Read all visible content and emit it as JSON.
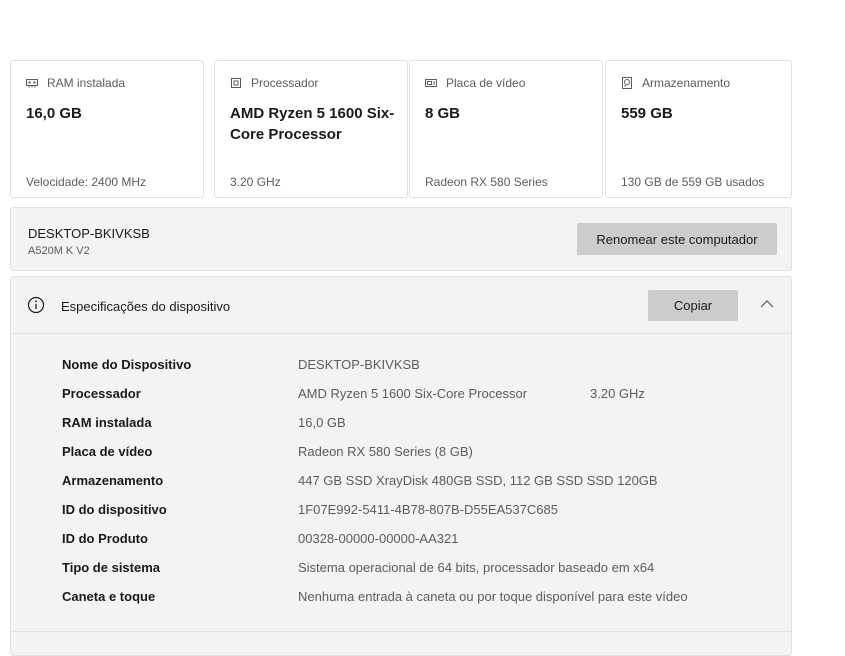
{
  "cards": [
    {
      "icon": "ram-icon",
      "title": "RAM instalada",
      "value": "16,0 GB",
      "footer": "Velocidade: 2400 MHz"
    },
    {
      "icon": "processor-icon",
      "title": "Processador",
      "value": "AMD Ryzen 5 1600 Six-Core Processor",
      "footer": "3.20 GHz"
    },
    {
      "icon": "gpu-icon",
      "title": "Placa de vídeo",
      "value": "8 GB",
      "footer": "Radeon RX 580 Series"
    },
    {
      "icon": "storage-icon",
      "title": "Armazenamento",
      "value": "559 GB",
      "footer": "130 GB de 559 GB usados"
    }
  ],
  "device": {
    "name": "DESKTOP-BKIVKSB",
    "model": "A520M K V2",
    "rename_label": "Renomear este computador"
  },
  "specs": {
    "title": "Especificações do dispositivo",
    "copy_label": "Copiar",
    "rows": [
      {
        "label": "Nome do Dispositivo",
        "value": "DESKTOP-BKIVKSB",
        "extra": ""
      },
      {
        "label": "Processador",
        "value": "AMD Ryzen 5 1600 Six-Core Processor",
        "extra": "3.20 GHz"
      },
      {
        "label": "RAM instalada",
        "value": "16,0 GB",
        "extra": ""
      },
      {
        "label": "Placa de vídeo",
        "value": "Radeon RX 580 Series (8 GB)",
        "extra": ""
      },
      {
        "label": "Armazenamento",
        "value": "447 GB SSD XrayDisk 480GB SSD, 112 GB SSD SSD 120GB",
        "extra": ""
      },
      {
        "label": "ID do dispositivo",
        "value": "1F07E992-5411-4B78-807B-D55EA537C685",
        "extra": ""
      },
      {
        "label": "ID do Produto",
        "value": "00328-00000-00000-AA321",
        "extra": ""
      },
      {
        "label": "Tipo de sistema",
        "value": "Sistema operacional de 64 bits, processador baseado em x64",
        "extra": ""
      },
      {
        "label": "Caneta e toque",
        "value": "Nenhuma entrada à caneta ou por toque disponível para este vídeo",
        "extra": ""
      }
    ]
  }
}
